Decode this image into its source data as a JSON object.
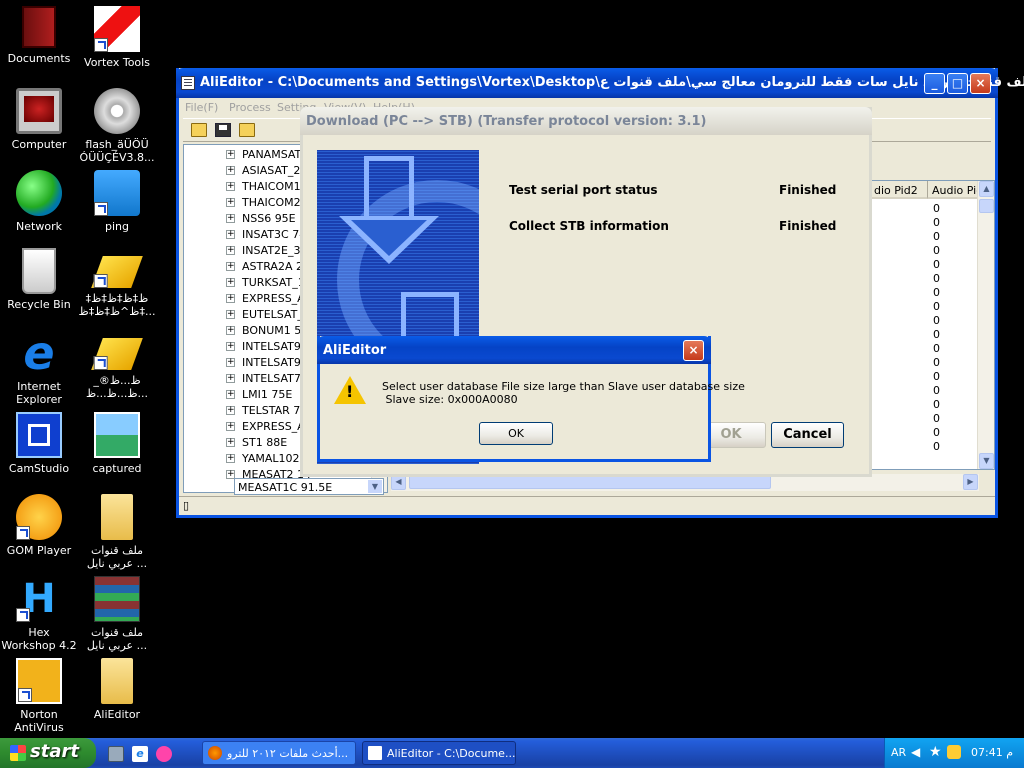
{
  "desktop": {
    "icons": [
      {
        "label": "Documents"
      },
      {
        "label": "Vortex Tools"
      },
      {
        "label": "Computer"
      },
      {
        "label": "flash_äÜÖÜ ÓÜÜÇÉV3.8..."
      },
      {
        "label": "Network"
      },
      {
        "label": "ping"
      },
      {
        "label": "Recycle Bin"
      },
      {
        "label": "ظ‡ظ‡ظ‡ظ‡ ظ^ظ‡ظ‡ظ‡..."
      },
      {
        "label": "Internet Explorer"
      },
      {
        "label": "ظ...ظ®_ ظ...ظ...ظ..."
      },
      {
        "label": "CamStudio"
      },
      {
        "label": "captured"
      },
      {
        "label": "GOM Player"
      },
      {
        "label": "ملف قنوات عربي نايل ..."
      },
      {
        "label": "Hex Workshop 4.2"
      },
      {
        "label": "ملف قنوات عربي نايل ..."
      },
      {
        "label": "Norton AntiVirus"
      },
      {
        "label": "AliEditor"
      }
    ]
  },
  "main_window": {
    "title": "AliEditor - C:\\Documents and Settings\\Vortex\\Desktop\\ملف قنوات عربي نايل سات فقط للترومان معالج سي\\ملف قنوات ع...",
    "minimize": "_",
    "maximize": "□",
    "close": "×",
    "menu": [
      "File(F)",
      "Process",
      "Setting",
      "View(V)",
      "Help(H)"
    ],
    "tree": {
      "expand_glyph": "+",
      "items": [
        "PANAMSAT2",
        "ASIASAT_2",
        "THAICOM1A",
        "THAICOM2_",
        "NSS6 95E",
        "INSAT3C 74E",
        "INSAT2E_3B",
        "ASTRA2A 28",
        "TURKSAT_1E",
        "EXPRESS_AM",
        "EUTELSAT_F",
        "BONUM1 56E",
        "INTELSAT90",
        "INTELSAT90",
        "INTELSAT70",
        "LMI1 75E",
        "TELSTAR 76.",
        "EXPRESS_AM",
        "ST1 88E",
        "YAMAL102 9",
        "MEASAT2 14"
      ]
    },
    "grid": {
      "columns": [
        "dio Pid2",
        "Audio Pic"
      ],
      "values": [
        "0",
        "0",
        "0",
        "0",
        "0",
        "0",
        "0",
        "0",
        "0",
        "0",
        "0",
        "0",
        "0",
        "0",
        "0",
        "0",
        "0",
        "0"
      ]
    },
    "combo_value": "MEASAT1C 91.5E",
    "status_left": "▯"
  },
  "download_dialog": {
    "title": "Download (PC --> STB) (Transfer protocol version: 3.1)",
    "tasks": [
      {
        "label": "Test serial port status",
        "status": "Finished"
      },
      {
        "label": "Collect STB information",
        "status": "Finished"
      }
    ],
    "ok_label": "OK",
    "cancel_label": "Cancel"
  },
  "alert": {
    "title": "AliEditor",
    "message": "Select user database File size large than Slave user database size\n Slave size: 0x000A0080",
    "ok_label": "OK",
    "close": "×"
  },
  "taskbar": {
    "start_label": "start",
    "tasks": [
      {
        "label": "أحدث ملفات ٢٠١٢ للترو..."
      },
      {
        "label": "AliEditor - C:\\Docume..."
      }
    ],
    "tray": {
      "language": "AR",
      "time": "07:41 م"
    }
  },
  "colors": {
    "xp_blue": "#0a54e3",
    "desktop": "#000000",
    "start_green": "#2e8b2e",
    "tray_blue": "#0c8fe0"
  }
}
